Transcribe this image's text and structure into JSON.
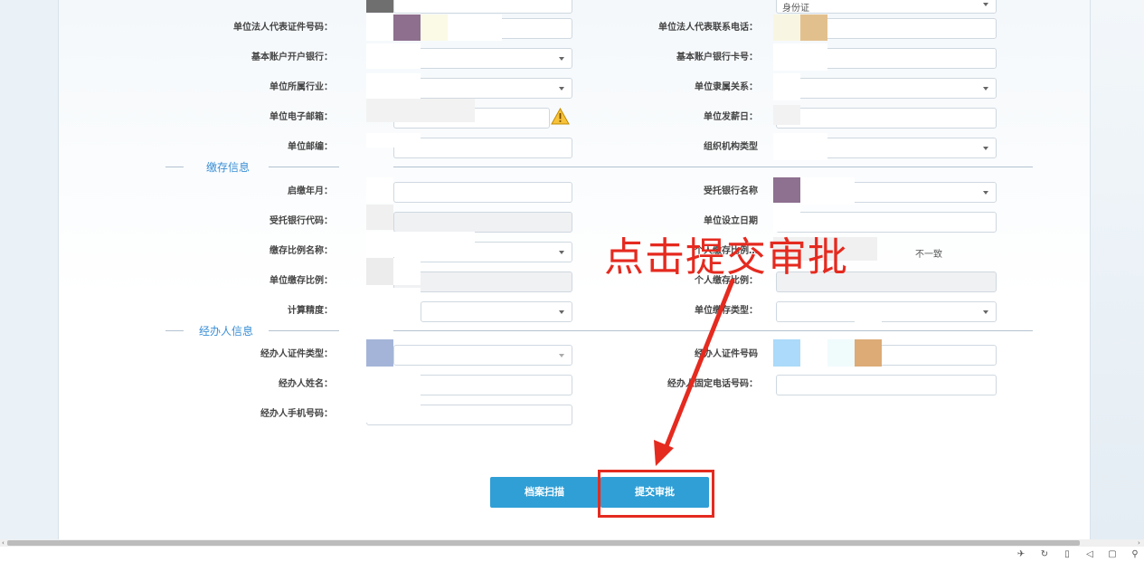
{
  "left_form": {
    "rows": [
      {
        "label": "单位法人代表证件号码："
      },
      {
        "label": "基本账户开户银行："
      },
      {
        "label": "单位所属行业："
      },
      {
        "label": "单位电子邮箱："
      },
      {
        "label": "单位邮编："
      }
    ]
  },
  "right_form": {
    "top_partial_value": "身份证",
    "rows": [
      {
        "label": "单位法人代表联系电话："
      },
      {
        "label": "基本账户银行卡号："
      },
      {
        "label": "单位隶属关系："
      },
      {
        "label": "单位发薪日："
      },
      {
        "label": "组织机构类型"
      }
    ]
  },
  "sections": {
    "deposit": {
      "title": "缴存信息",
      "left_rows": [
        {
          "label": "启缴年月："
        },
        {
          "label": "受托银行代码："
        },
        {
          "label": "缴存比例名称："
        },
        {
          "label": "单位缴存比例："
        },
        {
          "label": "计算精度："
        }
      ],
      "right_rows": [
        {
          "label": "受托银行名称"
        },
        {
          "label": "单位设立日期"
        },
        {
          "label": "个人缴存比例…"
        },
        {
          "label": "个人缴存比例："
        },
        {
          "label": "单位缴存类型："
        }
      ],
      "mismatch_text": "不一致"
    },
    "agent": {
      "title": "经办人信息",
      "left_rows": [
        {
          "label": "经办人证件类型："
        },
        {
          "label": "经办人姓名："
        },
        {
          "label": "经办人手机号码："
        }
      ],
      "right_rows": [
        {
          "label": "经办人证件号码"
        },
        {
          "label": "经办人固定电话号码："
        }
      ]
    }
  },
  "buttons": {
    "scan": "档案扫描",
    "submit": "提交审批"
  },
  "annotation": {
    "text": "点击提交审批",
    "color": "#e52a1f"
  },
  "statusbar": {
    "icons": [
      "rocket-icon",
      "refresh-icon",
      "trash-icon",
      "speaker-icon",
      "window-icon",
      "search-icon"
    ]
  }
}
